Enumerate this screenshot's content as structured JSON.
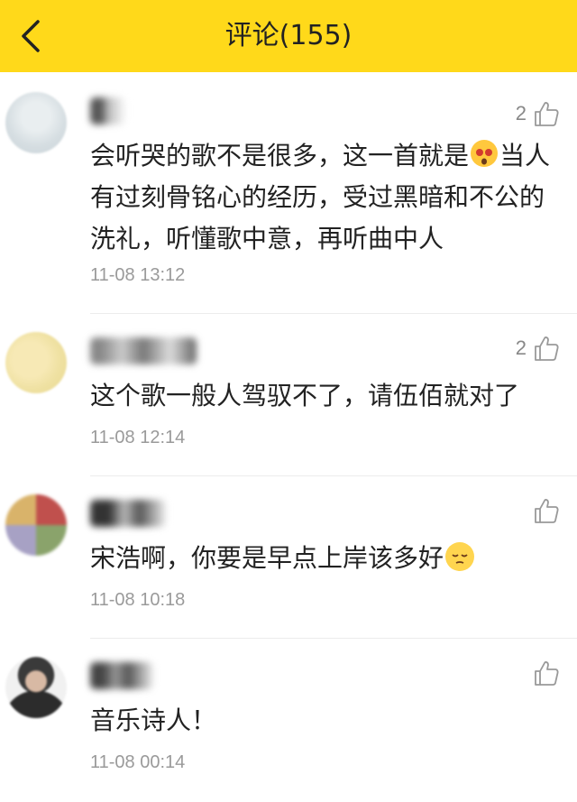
{
  "header": {
    "title": "评论(155)"
  },
  "comments": [
    {
      "likes": "2",
      "text_parts": [
        "会听哭的歌不是很多，这一首就是",
        "当人有过刻骨铭心的经历，受过黑暗和不公的洗礼，听懂歌中意，再听曲中人"
      ],
      "emoji": "astonished-emoji",
      "time": "11-08 13:12"
    },
    {
      "likes": "2",
      "text": "这个歌一般人驾驭不了，请伍佰就对了",
      "time": "11-08 12:14"
    },
    {
      "likes": "",
      "text_parts": [
        "宋浩啊，你要是早点上岸该多好",
        ""
      ],
      "emoji": "pensive-emoji",
      "time": "11-08 10:18"
    },
    {
      "likes": "",
      "text": "音乐诗人！",
      "time": "11-08 00:14"
    }
  ],
  "colors": {
    "header_bg": "#ffd91a",
    "time": "#9a9a9a",
    "divider": "#ececec"
  }
}
